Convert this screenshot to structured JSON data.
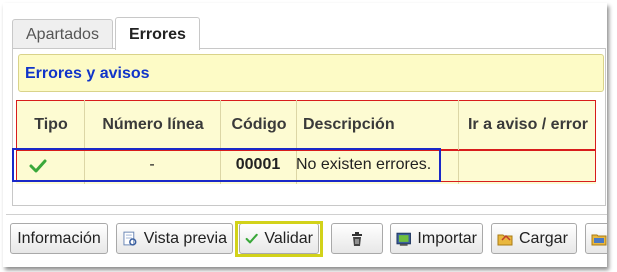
{
  "tabs": [
    {
      "label": "Apartados"
    },
    {
      "label": "Errores"
    }
  ],
  "notice": {
    "title": "Errores y avisos"
  },
  "table": {
    "columns": [
      "Tipo",
      "Número línea",
      "Código",
      "Descripción",
      "Ir a aviso / error"
    ],
    "rows": [
      {
        "tipo_icon": "check-icon",
        "numero_linea": "-",
        "codigo": "00001",
        "descripcion": "No existen errores.",
        "ir_a": ""
      }
    ]
  },
  "toolbar": {
    "buttons": [
      {
        "label": "Información",
        "icon": "none"
      },
      {
        "label": "Vista previa",
        "icon": "document-preview-icon"
      },
      {
        "label": "Validar",
        "icon": "check-icon"
      },
      {
        "label": "",
        "icon": "trash-icon"
      },
      {
        "label": "Importar",
        "icon": "import-icon"
      },
      {
        "label": "Cargar",
        "icon": "folder-load-icon"
      },
      {
        "label": "",
        "icon": "folder-icon"
      }
    ]
  },
  "colors": {
    "notice_bg": "#fdfbc6",
    "title_blue": "#1034c9",
    "error_red": "#d81c1c",
    "highlight_yellow": "#d2d21a",
    "check_green": "#3aa83a"
  }
}
